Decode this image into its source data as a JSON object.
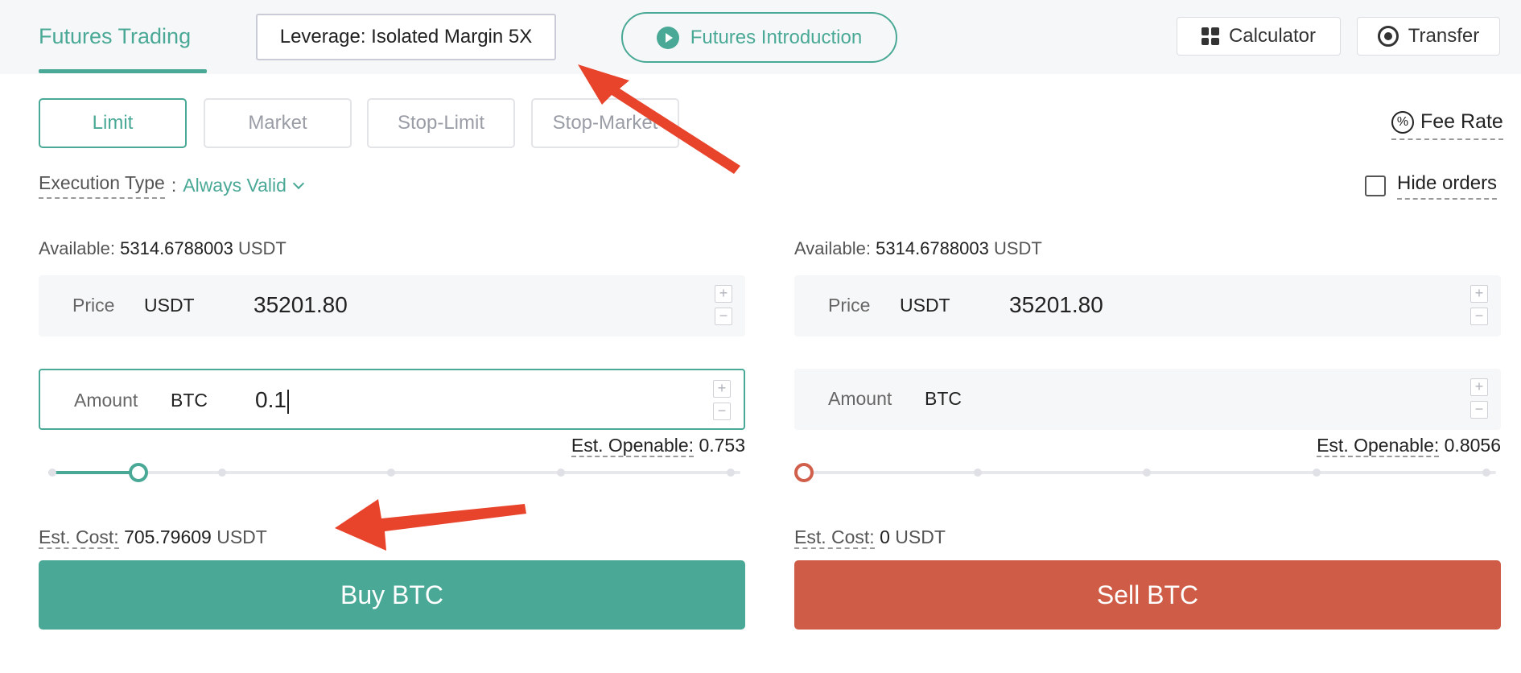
{
  "header": {
    "tab_futures": "Futures Trading",
    "leverage": "Leverage: Isolated Margin 5X",
    "intro": "Futures Introduction",
    "calculator": "Calculator",
    "transfer": "Transfer"
  },
  "order_types": [
    "Limit",
    "Market",
    "Stop-Limit",
    "Stop-Market"
  ],
  "active_order_type": "Limit",
  "fee_rate": "Fee Rate",
  "execution": {
    "label": "Execution Type",
    "colon": ":",
    "value": "Always Valid"
  },
  "hide_orders": "Hide orders",
  "buy_panel": {
    "available_label": "Available:",
    "available_value": "5314.6788003",
    "available_unit": "USDT",
    "price_label": "Price",
    "price_unit": "USDT",
    "price_value": "35201.80",
    "amount_label": "Amount",
    "amount_unit": "BTC",
    "amount_value": "0.1",
    "openable_label": "Est. Openable:",
    "openable_value": "0.753",
    "slider_percent": 13,
    "cost_label": "Est. Cost:",
    "cost_value": "705.79609",
    "cost_unit": "USDT",
    "button": "Buy BTC"
  },
  "sell_panel": {
    "available_label": "Available:",
    "available_value": "5314.6788003",
    "available_unit": "USDT",
    "price_label": "Price",
    "price_unit": "USDT",
    "price_value": "35201.80",
    "amount_label": "Amount",
    "amount_unit": "BTC",
    "amount_value": "",
    "openable_label": "Est. Openable:",
    "openable_value": "0.8056",
    "slider_percent": 0,
    "cost_label": "Est. Cost:",
    "cost_value": "0",
    "cost_unit": "USDT",
    "button": "Sell BTC"
  },
  "colors": {
    "accent": "#4aa996",
    "sell": "#cf5c47",
    "arrow": "#e8432b"
  }
}
